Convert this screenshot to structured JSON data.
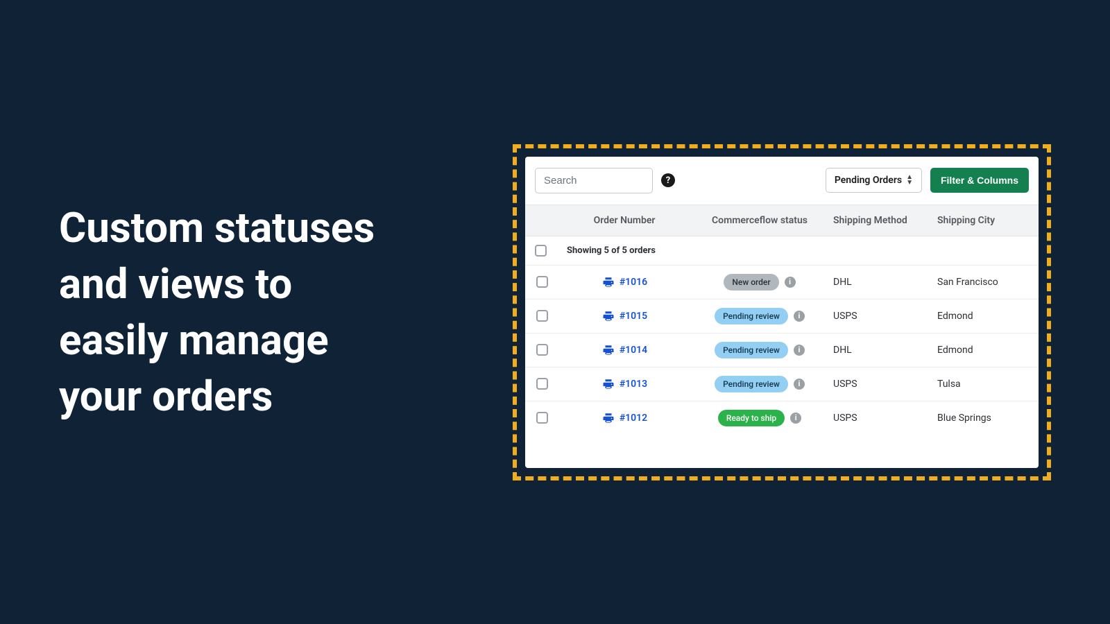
{
  "headline": "Custom statuses and views to easily manage your orders",
  "toolbar": {
    "search_placeholder": "Search",
    "help_glyph": "?",
    "view_select_label": "Pending Orders",
    "filter_button_label": "Filter & Columns"
  },
  "table": {
    "headers": {
      "order_number": "Order Number",
      "status": "Commerceflow status",
      "shipping_method": "Shipping Method",
      "shipping_city": "Shipping City"
    },
    "count_text": "Showing 5 of 5 orders",
    "rows": [
      {
        "order": "#1016",
        "status": "New order",
        "status_style": "gray",
        "shipping": "DHL",
        "city": "San Francisco"
      },
      {
        "order": "#1015",
        "status": "Pending review",
        "status_style": "blue",
        "shipping": "USPS",
        "city": "Edmond"
      },
      {
        "order": "#1014",
        "status": "Pending review",
        "status_style": "blue",
        "shipping": "DHL",
        "city": "Edmond"
      },
      {
        "order": "#1013",
        "status": "Pending review",
        "status_style": "blue",
        "shipping": "USPS",
        "city": "Tulsa"
      },
      {
        "order": "#1012",
        "status": "Ready to ship",
        "status_style": "green",
        "shipping": "USPS",
        "city": "Blue Springs"
      }
    ]
  },
  "colors": {
    "bg": "#0f2236",
    "accent_dash": "#f0ad1d",
    "link": "#1551d1",
    "filter_btn": "#147f4f"
  }
}
